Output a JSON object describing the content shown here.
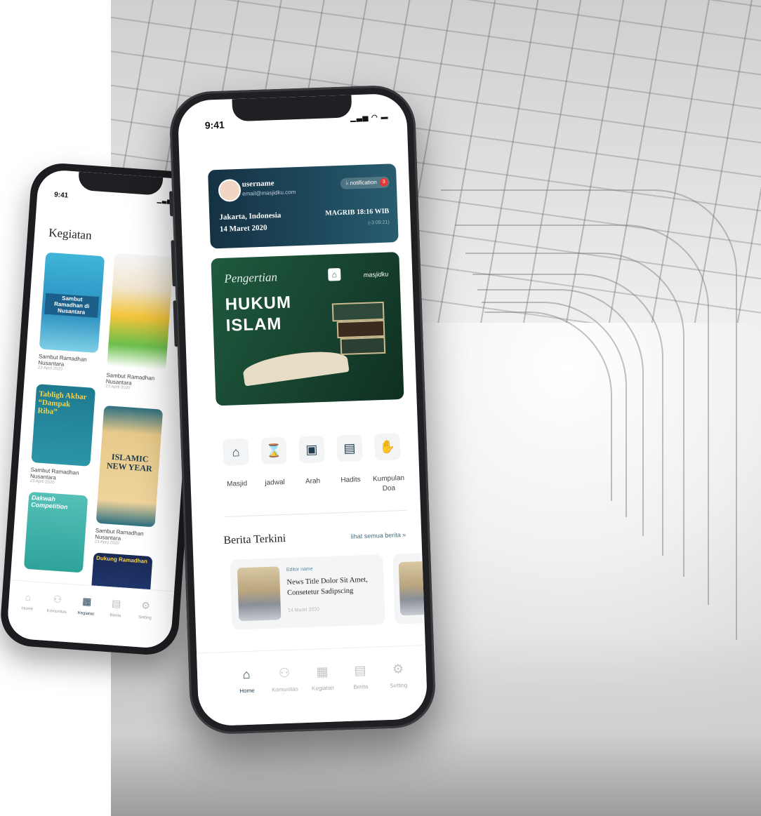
{
  "back_phone": {
    "status_time": "9:41",
    "status_icons": "▁▃▅ ◠ ▬",
    "title": "Kegiatan",
    "search_icon": "⌕",
    "cards": [
      {
        "overlay": "Sambut Ramadhan di Nusantara",
        "caption": "Sambut Ramadhan Nusantara",
        "date": "23 April 2020"
      },
      {
        "overlay": "",
        "caption": "Sambut Ramadhan Nusantara",
        "date": "23 April 2020"
      },
      {
        "overlay": "Tabligh Akbar “Dampak Riba”",
        "caption": "Sambut Ramadhan Nusantara",
        "date": "23 April 2020"
      },
      {
        "overlay": "ISLAMIC NEW YEAR",
        "caption": "Sambut Ramadhan Nusantara",
        "date": "23 April 2020"
      },
      {
        "overlay": "Dakwah Competition",
        "caption": "",
        "date": ""
      },
      {
        "overlay": "Dukung Ramadhan",
        "caption": "",
        "date": ""
      }
    ],
    "nav": [
      {
        "label": "Home",
        "icon": "⌂"
      },
      {
        "label": "Komunitas",
        "icon": "⚇"
      },
      {
        "label": "Kegiatan",
        "icon": "▦"
      },
      {
        "label": "Berita",
        "icon": "▤"
      },
      {
        "label": "Setting",
        "icon": "⚙"
      }
    ]
  },
  "front_phone": {
    "status_time": "9:41",
    "status_icons": "▁▃▅ ◠ ▬",
    "header": {
      "username": "username",
      "email": "email@masjidku.com",
      "notification_label": "notification",
      "notification_count": "3",
      "city": "Jakarta, Indonesia",
      "date": "14 Maret 2020",
      "prayer": "MAGRIB 18:16 WIB",
      "countdown": "(-3:09:21)"
    },
    "banner": {
      "subtitle": "Pengertian",
      "title_line1": "HUKUM",
      "title_line2": "ISLAM",
      "brand": "masjidku"
    },
    "menu": [
      {
        "label": "Masjid",
        "icon": "⌂"
      },
      {
        "label": "jadwal",
        "icon": "⌛"
      },
      {
        "label": "Arah",
        "icon": "▣"
      },
      {
        "label": "Hadits",
        "icon": "▤"
      },
      {
        "label": "Kumpulan Doa",
        "icon": "✋"
      }
    ],
    "section_title": "Berita Terkini",
    "section_link": "lihat semua berita »",
    "news": {
      "editor": "Editor name",
      "title": "News Title Dolor Sit Amet, Consetetur Sadipscing",
      "date": "14 Maret 2020"
    },
    "nav": [
      {
        "label": "Home",
        "icon": "⌂"
      },
      {
        "label": "Komunitas",
        "icon": "⚇"
      },
      {
        "label": "Kegiatan",
        "icon": "▦"
      },
      {
        "label": "Berita",
        "icon": "▤"
      },
      {
        "label": "Setting",
        "icon": "⚙"
      }
    ]
  },
  "colors": {
    "primary": "#1d3b4a",
    "header_bg": "#153243",
    "banner_bg": "#1f5a3e",
    "notification_badge": "#e53935"
  }
}
